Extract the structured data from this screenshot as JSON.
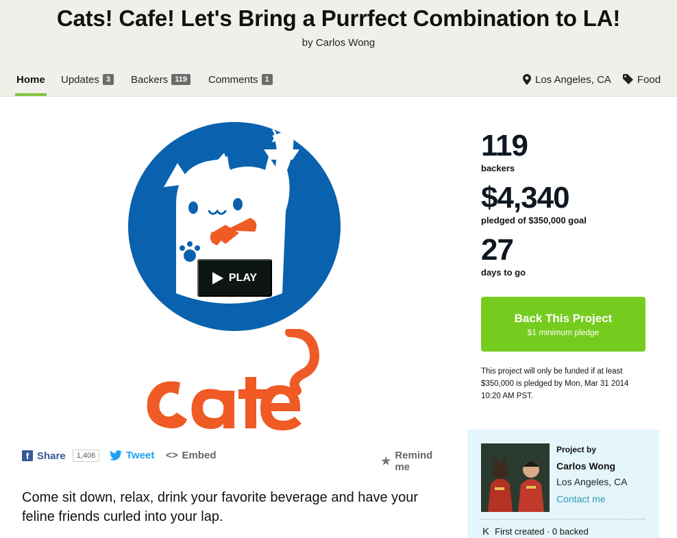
{
  "project": {
    "title": "Cats! Cafe! Let's Bring a Purrfect Combination to LA!",
    "byline": "by Carlos Wong"
  },
  "tabs": [
    {
      "label": "Home",
      "count": ""
    },
    {
      "label": "Updates",
      "count": "3"
    },
    {
      "label": "Backers",
      "count": "119"
    },
    {
      "label": "Comments",
      "count": "1"
    }
  ],
  "meta": {
    "location": "Los Angeles, CA",
    "category": "Food",
    "location_icon": "map-pin-icon",
    "category_icon": "tag-icon"
  },
  "video": {
    "play_label": "PLAY"
  },
  "social": {
    "share_label": "Share",
    "share_count": "1,406",
    "tweet_label": "Tweet",
    "embed_label": "Embed",
    "remind_label": "Remind me"
  },
  "blurb": "Come sit down, relax, drink your favorite beverage and have your feline friends curled into your lap.",
  "stats": {
    "backers_num": "119",
    "backers_lbl": "backers",
    "pledged_num": "$4,340",
    "pledged_lbl": "pledged of $350,000 goal",
    "days_num": "27",
    "days_lbl": "days to go"
  },
  "cta": {
    "label": "Back This Project",
    "sub": "$1 minimum pledge"
  },
  "funding_note": "This project will only be funded if at least $350,000 is pledged by Mon, Mar 31 2014 10:20 AM PST.",
  "creator": {
    "label": "Project by",
    "name": "Carlos Wong",
    "location": "Los Angeles, CA",
    "contact": "Contact me",
    "history": "First created · 0 backed"
  },
  "colors": {
    "accent_green": "#76cc1e",
    "tab_underline": "#84c43e",
    "video_blue": "#0a62ae",
    "cafe_orange": "#f05a24",
    "twitter_blue": "#1da1f2",
    "facebook_blue": "#3b5998",
    "link_teal": "#2a9ab5"
  }
}
